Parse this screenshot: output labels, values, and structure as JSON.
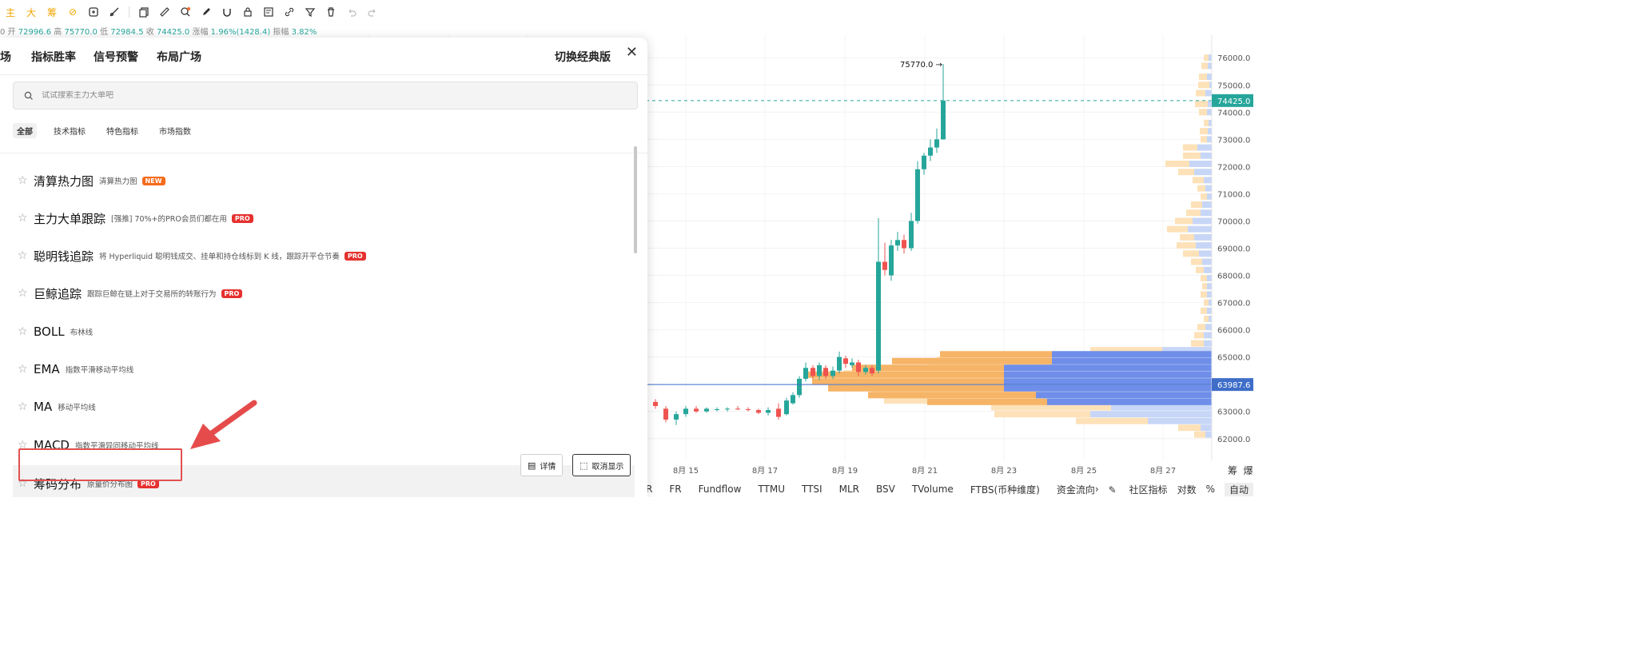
{
  "toolbar": {
    "left_tools": [
      {
        "label": "主",
        "icon": "main-force-text",
        "color": "#f0a500"
      },
      {
        "label": "大",
        "icon": "big-order-text",
        "color": "#f0a500"
      },
      {
        "label": "筹",
        "icon": "chip-text",
        "color": "#f0a500"
      },
      {
        "label": "⊘",
        "icon": "eraser-icon",
        "color": "#f0a500"
      }
    ],
    "tools": [
      "copy-icon",
      "ruler-icon",
      "zoom-icon",
      "pen-icon",
      "magnet-icon",
      "lock-icon",
      "template-icon",
      "link-icon",
      "filter-icon",
      "trash-icon",
      "undo-icon",
      "redo-icon"
    ]
  },
  "ohlc": {
    "open_label": "开",
    "open": "72996.6",
    "high_label": "高",
    "high": "75770.0",
    "low_label": "低",
    "low": "72984.5",
    "close_label": "收",
    "close": "74425.0",
    "change_label": "涨幅",
    "change": "1.96%(1428.4)",
    "amplitude_label": "振幅",
    "amplitude": "3.82%"
  },
  "chart_data": {
    "type": "candlestick",
    "price_ticks": [
      "76000.0",
      "75000.0",
      "74000.0",
      "73000.0",
      "72000.0",
      "71000.0",
      "70000.0",
      "69000.0",
      "68000.0",
      "67000.0",
      "66000.0",
      "65000.0",
      "64000.0",
      "63000.0",
      "62000.0"
    ],
    "last_price": "74425.0",
    "line_price": "63987.6",
    "high_annotation": "75770.0",
    "dates": [
      "8月 15",
      "8月 17",
      "8月 19",
      "8月 21",
      "8月 23",
      "8月 25",
      "8月 27"
    ],
    "ylim": [
      61700,
      76300
    ],
    "colors": {
      "up": "#26a69a",
      "down": "#ef5350",
      "volume_up": "#f9b76b",
      "volume_down": "#8aa4f0",
      "last_price_bg": "#26a69a",
      "line_price_bg": "#3f6ec9"
    }
  },
  "bottom_tabs": [
    "R",
    "FR",
    "Fundflow",
    "TTMU",
    "TTSI",
    "MLR",
    "BSV",
    "TVolume",
    "FTBS(币种维度)",
    "资金流向"
  ],
  "bottom_right": {
    "more": "›",
    "community": "社区指标",
    "log": "对数",
    "percent": "%",
    "auto": "自动"
  },
  "corner": {
    "chip": "筹",
    "burst": "爆"
  },
  "panel": {
    "tabs": [
      "场",
      "指标胜率",
      "信号预警",
      "布局广场"
    ],
    "switch_label": "切换经典版",
    "close": "✕",
    "search_placeholder": "试试搜索主力大单吧",
    "categories": [
      "全部",
      "技术指标",
      "特色指标",
      "市场指数"
    ],
    "items": [
      {
        "name": "清算热力图",
        "desc": "清算热力图",
        "badge": "NEW"
      },
      {
        "name": "主力大单跟踪",
        "desc": "[强推] 70%+的PRO会员们都在用",
        "badge": "PRO"
      },
      {
        "name": "聪明钱追踪",
        "desc": "将 Hyperliquid 聪明钱成交、挂单和持仓线标到 K 线，跟踪开平仓节奏",
        "badge": "PRO"
      },
      {
        "name": "巨鲸追踪",
        "desc": "跟踪巨鲸在链上对于交易所的转账行为",
        "badge": "PRO"
      },
      {
        "name": "BOLL",
        "desc": "布林线",
        "badge": ""
      },
      {
        "name": "EMA",
        "desc": "指数平滑移动平均线",
        "badge": ""
      },
      {
        "name": "MA",
        "desc": "移动平均线",
        "badge": ""
      },
      {
        "name": "MACD",
        "desc": "指数平滑异同移动平均线",
        "badge": ""
      },
      {
        "name": "筹码分布",
        "desc": "原量价分布图",
        "badge": "PRO"
      }
    ],
    "detail_label": "详情",
    "hide_label": "取消显示"
  }
}
